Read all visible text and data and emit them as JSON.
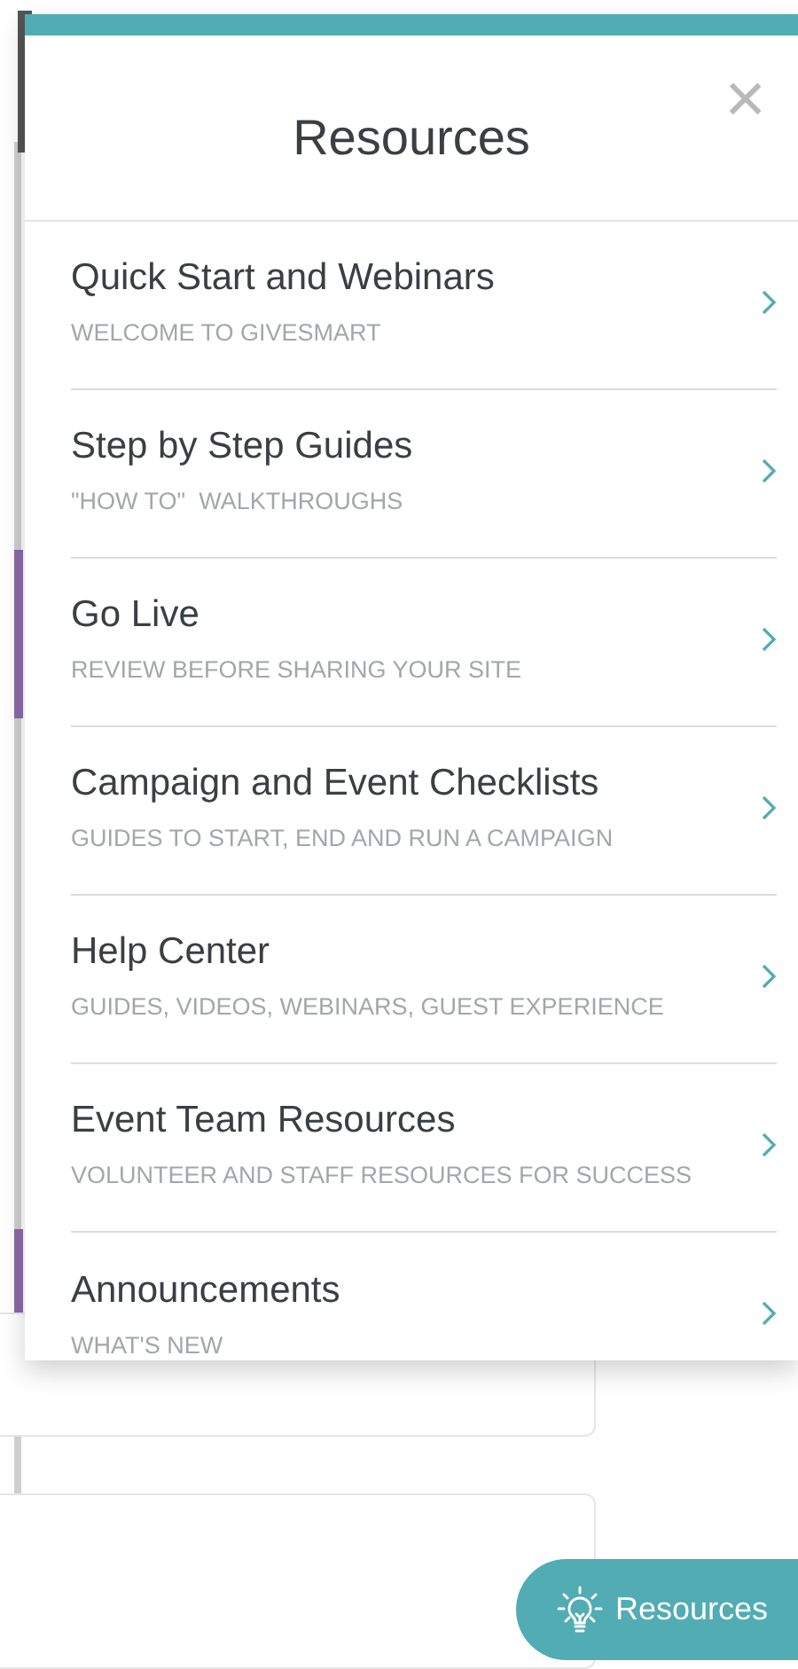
{
  "panel": {
    "title": "Resources",
    "close": "×"
  },
  "items": [
    {
      "title": "Quick Start and Webinars",
      "subtitle": "WELCOME TO GIVESMART"
    },
    {
      "title": "Step by Step Guides",
      "subtitle": "\"HOW TO\"  WALKTHROUGHS"
    },
    {
      "title": "Go Live",
      "subtitle": "REVIEW BEFORE SHARING YOUR SITE"
    },
    {
      "title": "Campaign and Event Checklists",
      "subtitle": "GUIDES TO START, END AND RUN A CAMPAIGN"
    },
    {
      "title": "Help Center",
      "subtitle": "GUIDES, VIDEOS, WEBINARS, GUEST EXPERIENCE"
    },
    {
      "title": "Event Team Resources",
      "subtitle": "VOLUNTEER AND STAFF RESOURCES FOR SUCCESS"
    },
    {
      "title": "Announcements",
      "subtitle": "WHAT'S NEW"
    }
  ],
  "resources_button": {
    "label": "Resources"
  }
}
